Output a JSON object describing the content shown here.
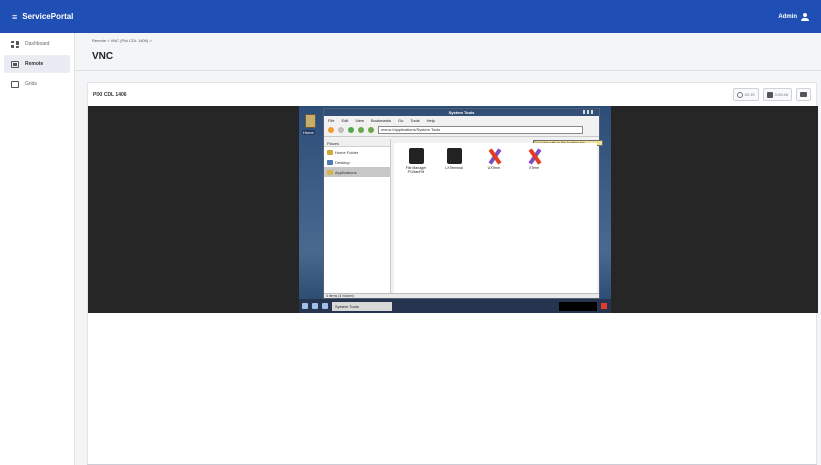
{
  "app": {
    "title": "ServicePortal",
    "user": "Admin",
    "menu_icon": "menu-icon",
    "user_icon": "user-icon"
  },
  "sidebar": {
    "items": [
      {
        "label": "Dashboard",
        "icon": "dashboard-icon"
      },
      {
        "label": "Remote",
        "icon": "remote-icon"
      },
      {
        "label": "Grids",
        "icon": "grid-icon"
      }
    ]
  },
  "header": {
    "breadcrumb": "Remote  >  VNC (Pixi CDL 1406)  >",
    "title": "VNC"
  },
  "viewer": {
    "label": "PIXI CDL 1406",
    "toolbar": {
      "button_1": "02:15",
      "button_2": "0:05:46"
    },
    "desktop": {
      "home_label": "Home",
      "window_title": "System Tools",
      "menu": [
        "File",
        "Edit",
        "View",
        "Bookmarks",
        "Go",
        "Tools",
        "Help"
      ],
      "path": "menu://applications/System Tools",
      "tooltip": "Go to the path in the location bar",
      "places_header": "Places",
      "places": [
        "Home Folder",
        "Desktop",
        "Applications"
      ],
      "files": [
        {
          "label": "File Manager PCManFM",
          "icon": "file-manager-icon"
        },
        {
          "label": "LXTerminal",
          "icon": "terminal-icon"
        },
        {
          "label": "UXTerm",
          "icon": "uxterm-icon"
        },
        {
          "label": "XTerm",
          "icon": "xterm-icon"
        }
      ],
      "status": "4 items (4 hidden)",
      "taskbar_task": "System Tools"
    }
  },
  "colors": {
    "primary": "#1f4fb5",
    "panel": "#ffffff",
    "background": "#f4f5f7",
    "vnc_background": "#262626"
  }
}
